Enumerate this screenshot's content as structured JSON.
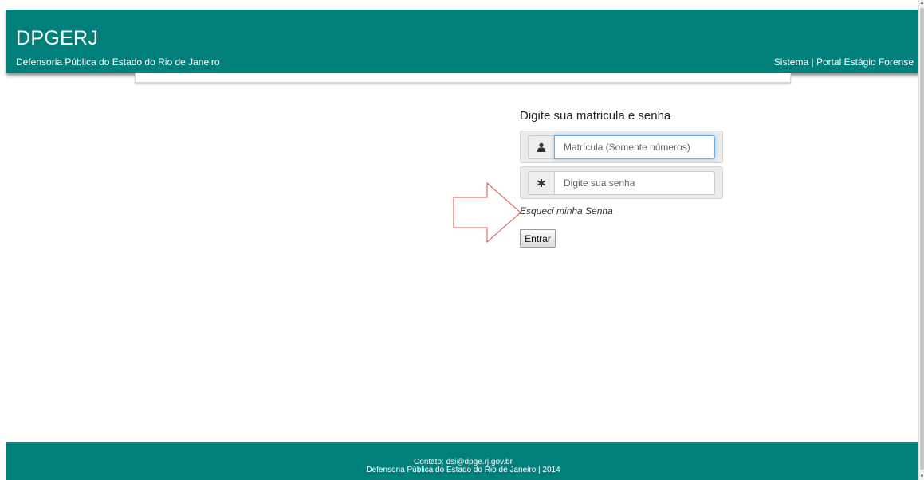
{
  "header": {
    "brand": "DPGERJ",
    "subtitle": "Defensoria Pública do Estado do Rio de Janeiro",
    "link_sistema": "Sistema",
    "separator": " | ",
    "link_portal": "Portal Estágio Forense",
    "background_color": "#007f7b"
  },
  "login": {
    "title": "Digite sua matricula e senha",
    "username": {
      "placeholder": "Matrícula (Somente números)",
      "value": "",
      "icon": "user-icon"
    },
    "password": {
      "placeholder": "Digite sua senha",
      "value": "",
      "icon": "asterisk-icon"
    },
    "forgot_link": "Esqueci minha Senha",
    "submit_label": "Entrar"
  },
  "annotation": {
    "icon": "arrow-right-icon",
    "color": "#d9534f"
  },
  "footer": {
    "contact": "Contato: dsi@dpge.rj.gov.br",
    "copyright": "Defensoria Pública do Estado do Rio de Janeiro | 2014"
  }
}
